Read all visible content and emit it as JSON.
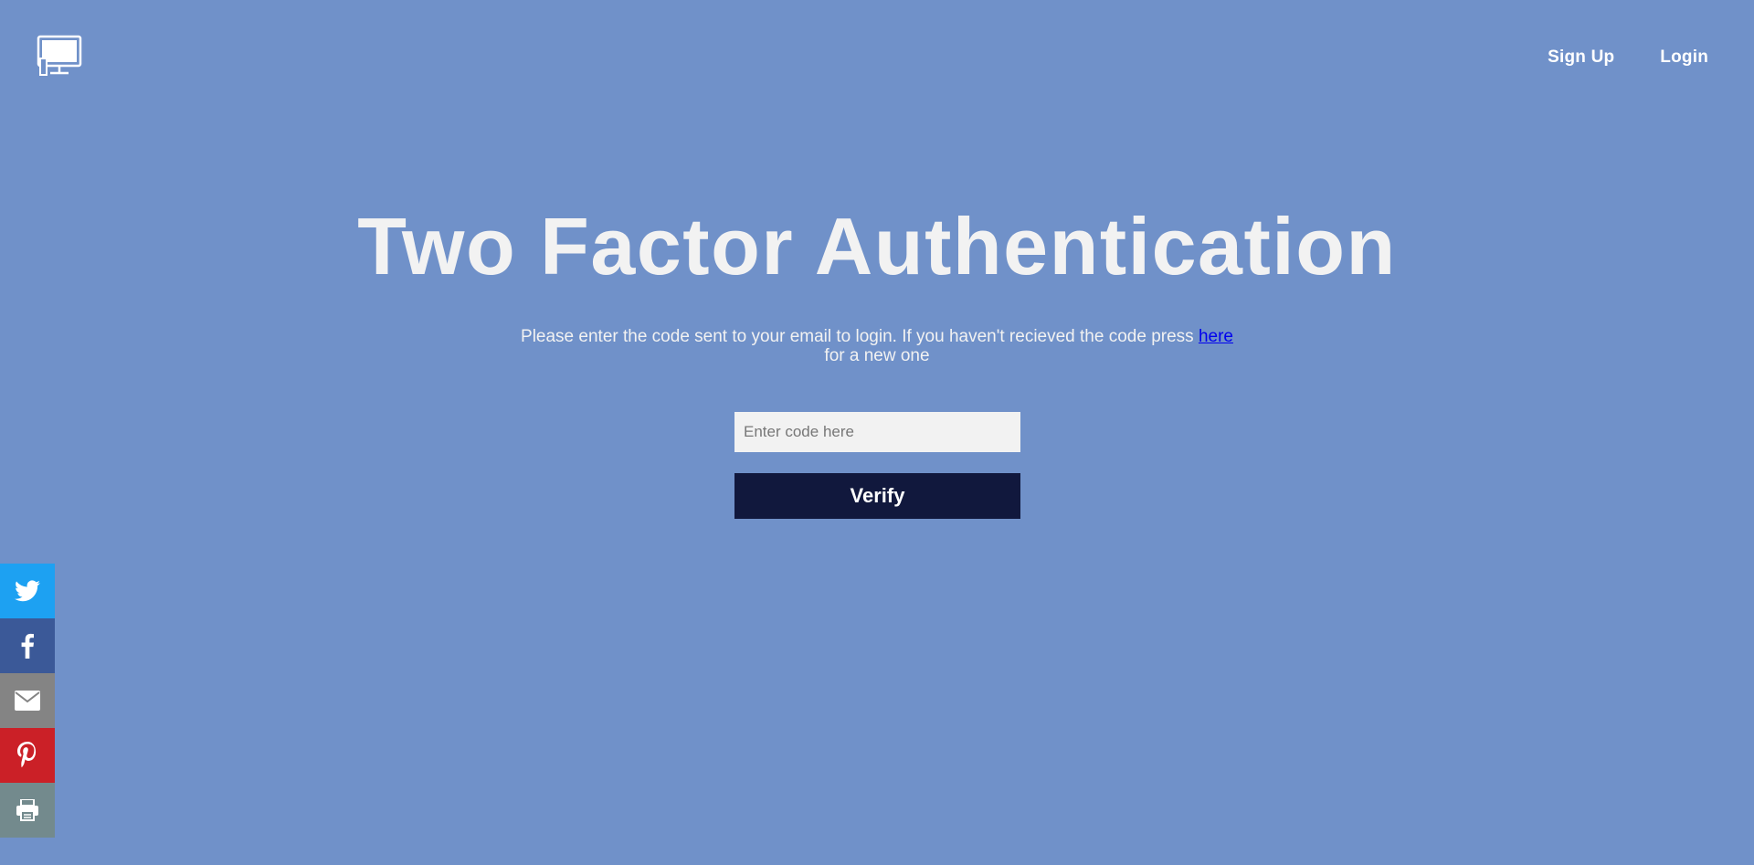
{
  "header": {
    "logo_icon": "monitor-icon",
    "nav": [
      {
        "label": "Sign Up"
      },
      {
        "label": "Login"
      }
    ]
  },
  "main": {
    "title": "Two Factor Authentication",
    "description_before": "Please enter the code sent to your email to login. If you haven't recieved the code press ",
    "description_link": "here",
    "description_after": " for a new one",
    "code_input": {
      "value": "",
      "placeholder": "Enter code here"
    },
    "verify_label": "Verify"
  },
  "share_bar": [
    {
      "name": "twitter",
      "icon": "twitter-icon",
      "color": "#1da1f2"
    },
    {
      "name": "facebook",
      "icon": "facebook-icon",
      "color": "#3b5998"
    },
    {
      "name": "email",
      "icon": "email-icon",
      "color": "#848484"
    },
    {
      "name": "pinterest",
      "icon": "pinterest-icon",
      "color": "#cb2027"
    },
    {
      "name": "print",
      "icon": "print-icon",
      "color": "#738a8d"
    }
  ],
  "colors": {
    "background": "#7091c9",
    "button": "#11183d",
    "link": "#0000ee"
  }
}
